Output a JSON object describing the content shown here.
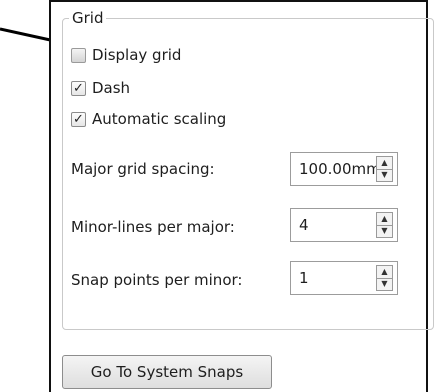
{
  "grid": {
    "title": "Grid",
    "checkboxes": [
      {
        "label": "Display grid",
        "checked": false
      },
      {
        "label": "Dash",
        "checked": true
      },
      {
        "label": "Automatic scaling",
        "checked": true
      }
    ],
    "fields": [
      {
        "label": "Major grid spacing:",
        "value": "100.00mm"
      },
      {
        "label": "Minor-lines per major:",
        "value": "4"
      },
      {
        "label": "Snap points per minor:",
        "value": "1"
      }
    ]
  },
  "check_glyph": "✓",
  "spin_up_glyph": "▲",
  "spin_down_glyph": "▼",
  "button_label": "Go To System Snaps",
  "callout": {
    "icon": "arrow-icon"
  }
}
